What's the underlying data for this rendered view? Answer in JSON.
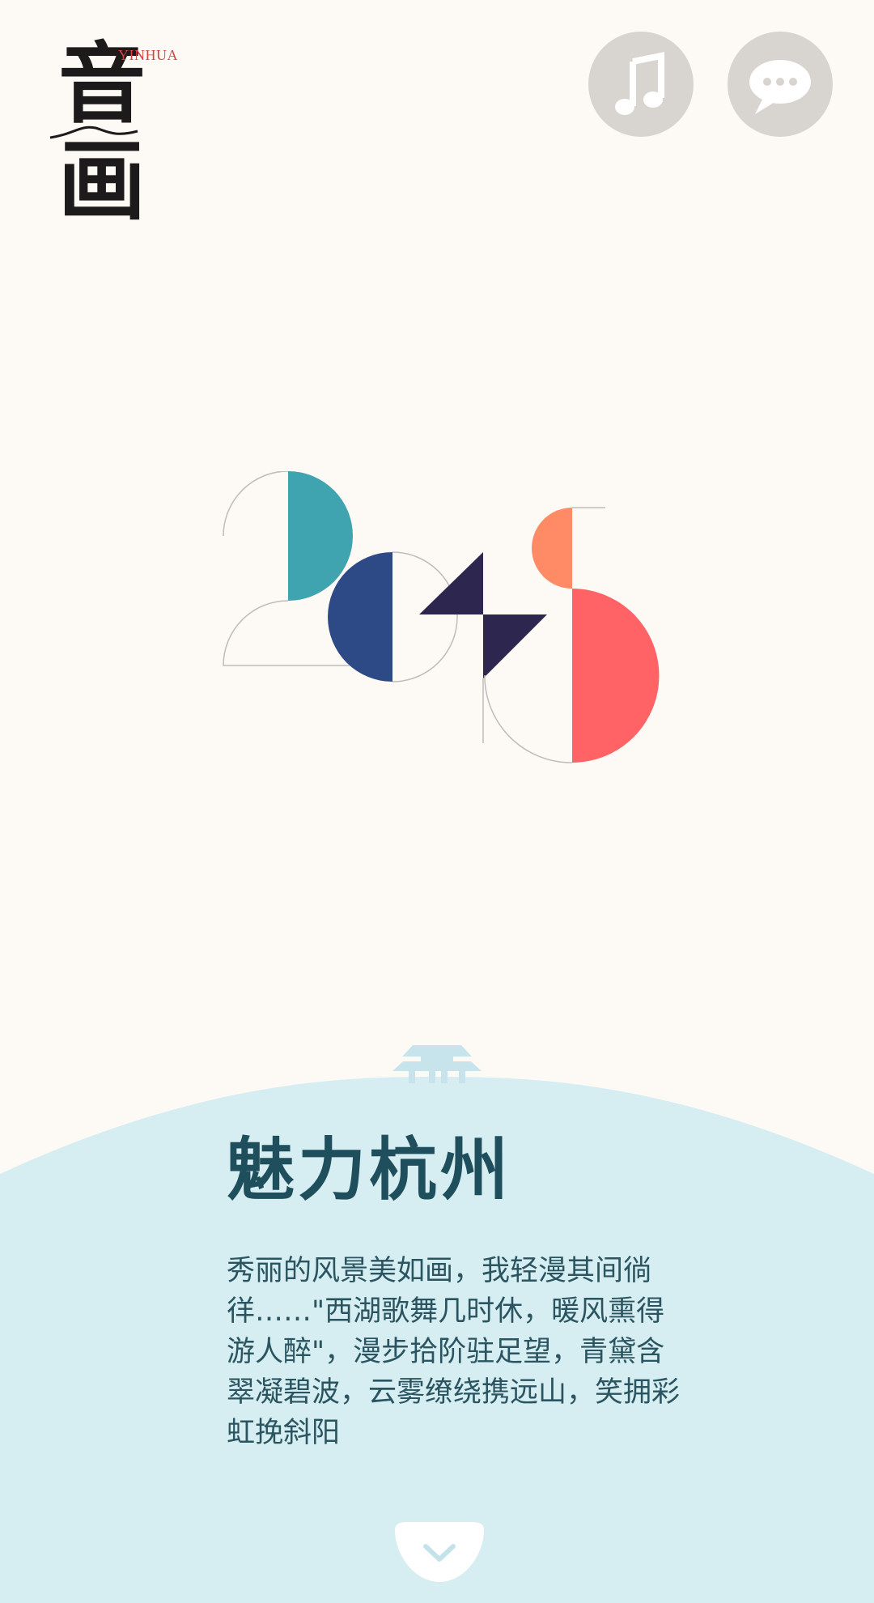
{
  "logo": {
    "glyph": "音画",
    "latin": "YINHUA",
    "icon": "yinhua-logo"
  },
  "header": {
    "music_icon": "music-note-icon",
    "chat_icon": "speech-bubble-icon",
    "button_bg": "#d8d4d0"
  },
  "hero": {
    "year_digits": [
      "2",
      "0",
      "4",
      "5"
    ],
    "colors": {
      "teal": "#3fa3b0",
      "navy": "#2e4a86",
      "dark_indigo": "#2d2750",
      "orange": "#ff8a66",
      "coral": "#ff6366"
    }
  },
  "section": {
    "title": "魅力杭州",
    "body": "秀丽的风景美如画，我轻漫其间徜徉……\"西湖歌舞几时休，暖风熏得游人醉\"，漫步拾阶驻足望，青黛含翠凝碧波，云雾缭绕携远山，笑拥彩虹挽斜阳",
    "bg_color": "#d6edf2",
    "pavilion_icon": "pavilion-icon"
  },
  "footer": {
    "next_icon": "chevron-down-icon"
  }
}
